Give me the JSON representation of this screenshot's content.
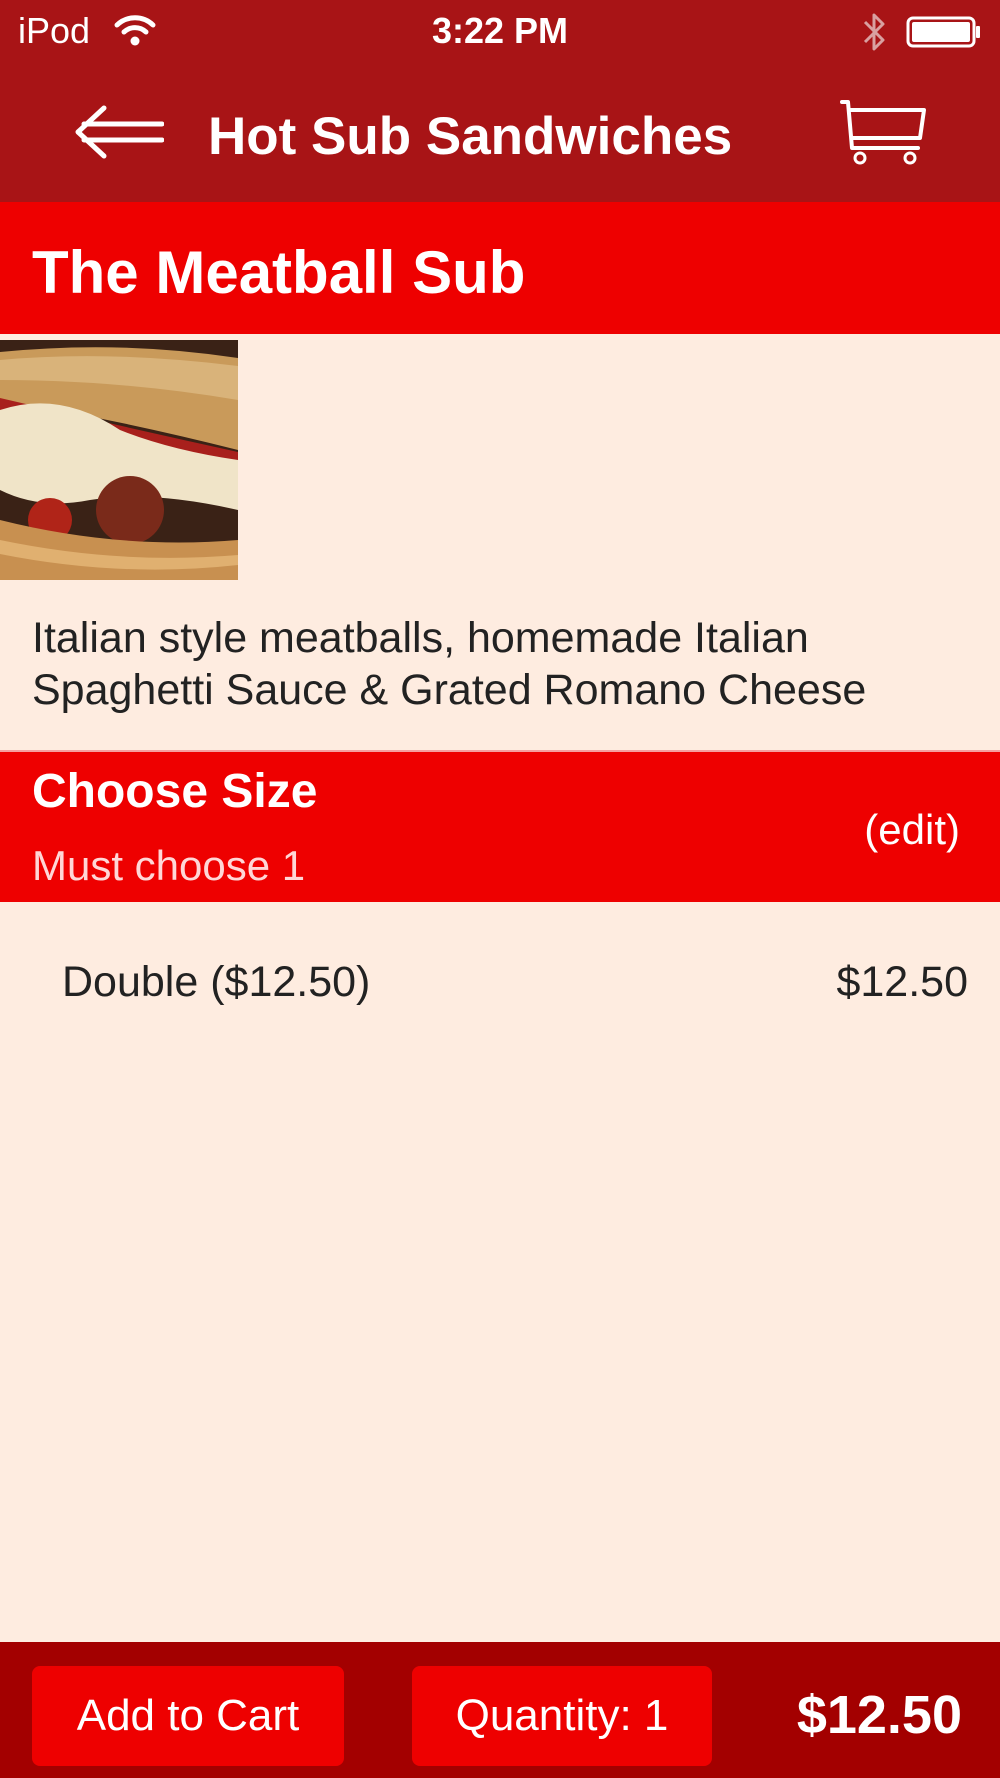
{
  "status_bar": {
    "carrier": "iPod",
    "time": "3:22 PM",
    "icons": [
      "wifi-icon",
      "bluetooth-icon",
      "battery-icon"
    ]
  },
  "nav": {
    "title": "Hot Sub Sandwiches",
    "back_icon": "back-arrow-icon",
    "cart_icon": "cart-icon"
  },
  "item": {
    "name": "The Meatball Sub",
    "description": "Italian style meatballs, homemade Italian Spaghetti Sauce & Grated Romano Cheese"
  },
  "options": {
    "title": "Choose Size",
    "subtitle": "Must choose 1",
    "edit_label": "(edit)",
    "selected": {
      "label": "Double ($12.50)",
      "price": "$12.50"
    }
  },
  "bottom_bar": {
    "add_to_cart_label": "Add to Cart",
    "quantity_label": "Quantity: 1",
    "total": "$12.50"
  },
  "colors": {
    "nav_background": "#a81416",
    "accent_red": "#ee0000",
    "bottom_bar": "#a30000",
    "page_background": "#feece0"
  }
}
